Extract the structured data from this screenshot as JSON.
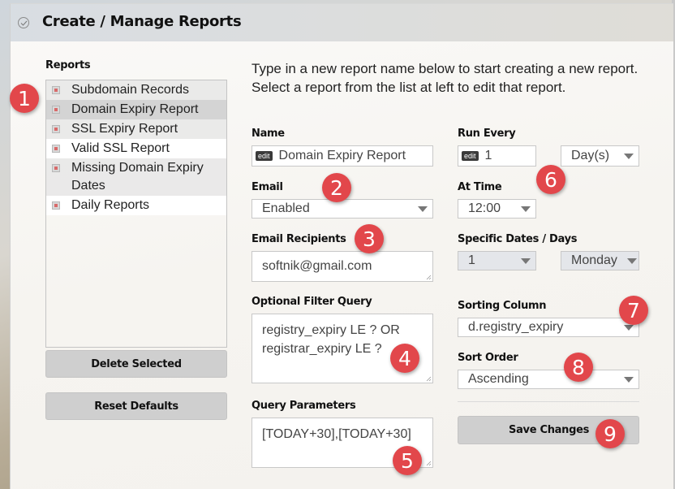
{
  "panel": {
    "title": "Create / Manage Reports",
    "collapse_icon": "circle-check-icon"
  },
  "reports": {
    "label": "Reports",
    "items": [
      {
        "label": "Subdomain Records",
        "icon": "report-icon",
        "selected": false
      },
      {
        "label": "Domain Expiry Report",
        "icon": "report-icon",
        "selected": true
      },
      {
        "label": "SSL Expiry Report",
        "icon": "report-icon",
        "selected": false
      },
      {
        "label": "Valid SSL Report",
        "icon": "report-icon",
        "selected": false
      },
      {
        "label": "Missing Domain Expiry Dates",
        "icon": "report-icon",
        "selected": false
      },
      {
        "label": "Daily Reports",
        "icon": "report-icon",
        "selected": false
      }
    ],
    "delete_label": "Delete Selected",
    "reset_label": "Reset Defaults"
  },
  "form": {
    "intro": "Type in a new report name below to start creating a new report. Select a report from the list at left to edit that report.",
    "name": {
      "label": "Name",
      "badge": "edit",
      "value": "Domain Expiry Report"
    },
    "email": {
      "label": "Email",
      "value": "Enabled"
    },
    "email_recipients": {
      "label": "Email Recipients",
      "value": "softnik@gmail.com"
    },
    "filter_query": {
      "label": "Optional Filter Query",
      "value": "registry_expiry LE ? OR registrar_expiry LE ?"
    },
    "query_params": {
      "label": "Query Parameters",
      "value": "[TODAY+30],[TODAY+30]"
    },
    "run_every": {
      "label": "Run Every",
      "badge": "edit",
      "value": "1",
      "unit": "Day(s)"
    },
    "at_time": {
      "label": "At Time",
      "value": "12:00"
    },
    "specific_dates": {
      "label": "Specific Dates / Days",
      "date_value": "1",
      "day_value": "Monday"
    },
    "sorting_column": {
      "label": "Sorting Column",
      "value": "d.registry_expiry"
    },
    "sort_order": {
      "label": "Sort Order",
      "value": "Ascending"
    },
    "save_label": "Save Changes"
  },
  "callouts": [
    "1",
    "2",
    "3",
    "4",
    "5",
    "6",
    "7",
    "8",
    "9"
  ],
  "colors": {
    "callout": "#e2474b",
    "button": "#cfcfcf",
    "selected_row": "#d4d4d4"
  }
}
